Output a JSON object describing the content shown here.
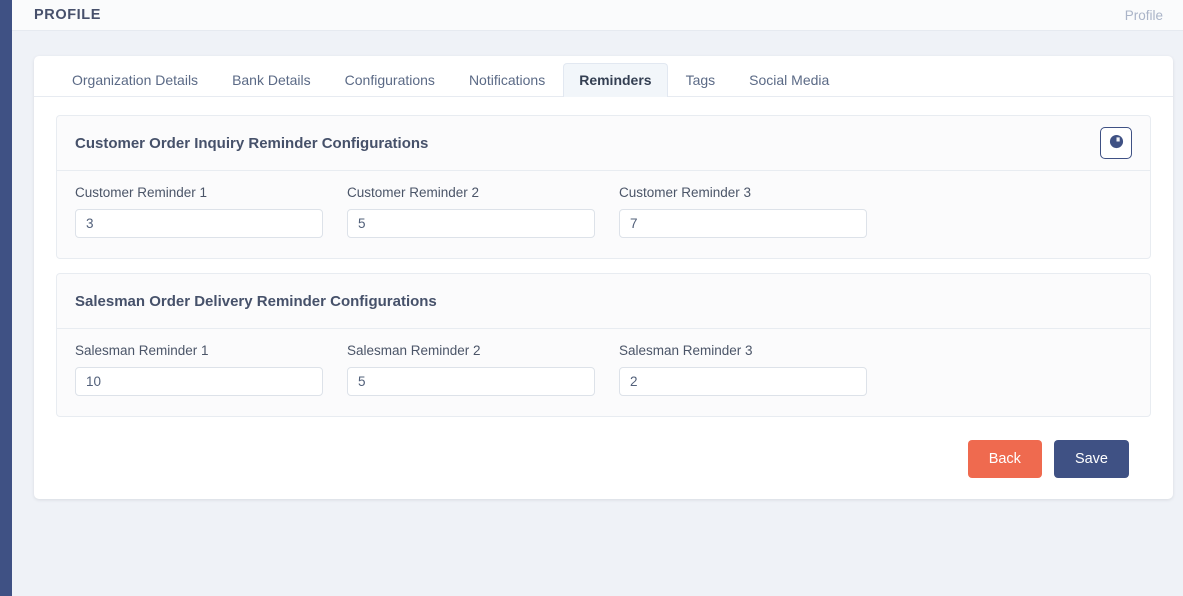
{
  "colors": {
    "rail": "#3f5184",
    "page_bg": "#eff2f7",
    "accent_primary": "#3f5184",
    "accent_danger": "#ef6a4f",
    "active_tab_bg": "#f2f6fa"
  },
  "topbar": {
    "title": "PROFILE",
    "breadcrumb": "Profile"
  },
  "tabs": [
    {
      "label": "Organization Details",
      "active": false
    },
    {
      "label": "Bank Details",
      "active": false
    },
    {
      "label": "Configurations",
      "active": false
    },
    {
      "label": "Notifications",
      "active": false
    },
    {
      "label": "Reminders",
      "active": true
    },
    {
      "label": "Tags",
      "active": false
    },
    {
      "label": "Social Media",
      "active": false
    }
  ],
  "panels": [
    {
      "title": "Customer Order Inquiry Reminder Configurations",
      "action_icon": "clock-history-icon",
      "fields": [
        {
          "label": "Customer Reminder 1",
          "value": "3",
          "placeholder": ""
        },
        {
          "label": "Customer Reminder 2",
          "value": "5",
          "placeholder": ""
        },
        {
          "label": "Customer Reminder 3",
          "value": "7",
          "placeholder": ""
        }
      ]
    },
    {
      "title": "Salesman Order Delivery Reminder Configurations",
      "action_icon": "",
      "fields": [
        {
          "label": "Salesman Reminder 1",
          "value": "10",
          "placeholder": ""
        },
        {
          "label": "Salesman Reminder 2",
          "value": "5",
          "placeholder": ""
        },
        {
          "label": "Salesman Reminder 3",
          "value": "2",
          "placeholder": ""
        }
      ]
    }
  ],
  "footer": {
    "back_label": "Back",
    "save_label": "Save"
  }
}
